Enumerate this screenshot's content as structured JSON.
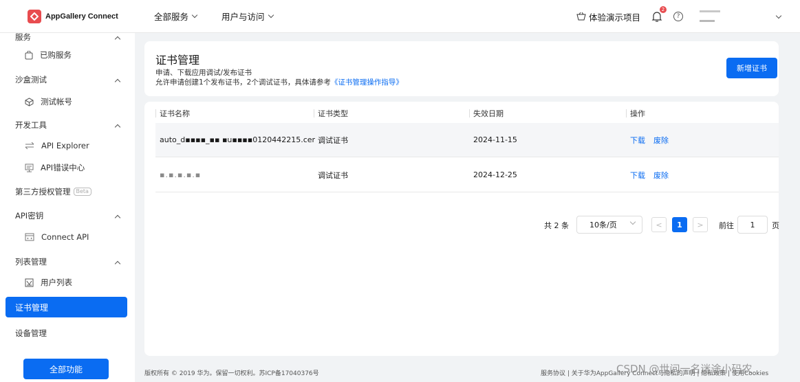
{
  "brand": {
    "name": "AppGallery Connect"
  },
  "topnav": {
    "all_services": "全部服务",
    "user_access": "用户与访问"
  },
  "topright": {
    "demo_project": "体验演示项目",
    "notification_count": "2"
  },
  "sidebar": {
    "groups": {
      "services": "服务",
      "sandbox": "沙盒测试",
      "dev_tools": "开发工具",
      "third_party": "第三方授权管理",
      "api_key": "API密钥",
      "list_mgmt": "列表管理",
      "cert_mgmt": "证书管理",
      "device_mgmt": "设备管理"
    },
    "items": {
      "purchased": "已购服务",
      "test_account": "测试帐号",
      "api_explorer": "API Explorer",
      "api_error_center": "API错误中心",
      "connect_api": "Connect API",
      "user_list": "用户列表"
    },
    "beta_label": "Beta",
    "all_functions": "全部功能"
  },
  "header": {
    "title": "证书管理",
    "desc1": "申请、下载应用调试/发布证书",
    "desc2": "允许申请创建1个发布证书，2个调试证书，具体请参考",
    "guide_link": "《证书管理操作指导》",
    "add_button": "新增证书"
  },
  "table": {
    "columns": [
      "证书名称",
      "证书类型",
      "失效日期",
      "操作"
    ],
    "rows": [
      {
        "name": "auto_d▪▪▪▪_▪▪ ▪u▪▪▪▪0120442215.cer",
        "type": "调试证书",
        "expiry": "2024-11-15",
        "download": "下载",
        "revoke": "废除"
      },
      {
        "name": "▪.▪.▪.▪.▪",
        "type": "调试证书",
        "expiry": "2024-12-25",
        "download": "下载",
        "revoke": "废除"
      }
    ]
  },
  "pagination": {
    "total": "共 2 条",
    "page_size": "10条/页",
    "prev": "<",
    "current": "1",
    "next": ">",
    "goto_label": "前往",
    "goto_value": "1",
    "page_unit": "页"
  },
  "footer": {
    "copyright": "版权所有 © 2019 华为。保留一切权利。苏ICP备17040376号",
    "links": "服务协议 | 关于华为AppGallery Connect与隐私的声明 | 隐私政策 | 使用Cookies"
  },
  "watermark": "CSDN @世间一名迷途小码农",
  "colors": {
    "accent": "#0a6cf2",
    "brand_red": "#e84c4f"
  }
}
